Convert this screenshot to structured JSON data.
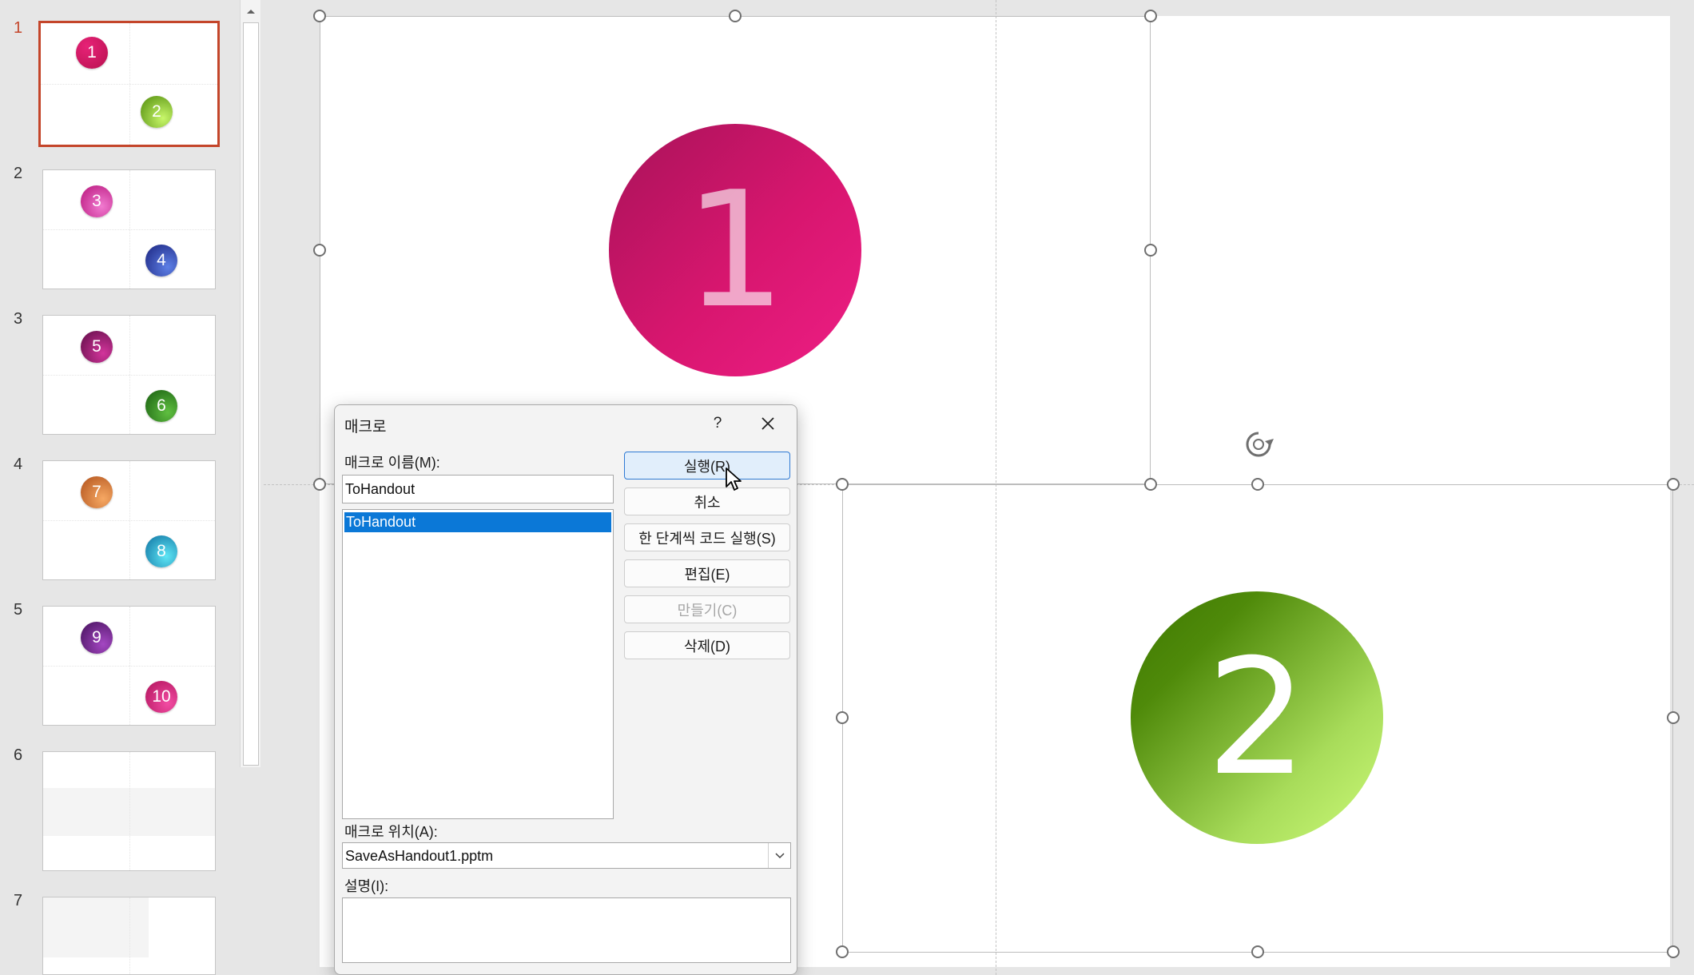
{
  "thumbnails": [
    {
      "num": "1",
      "balls": [
        "1",
        "2"
      ],
      "colors": [
        [
          "#c8145f",
          "#e72277"
        ],
        [
          "#4f8a0a",
          "#b8ef55"
        ]
      ]
    },
    {
      "num": "2",
      "balls": [
        "3",
        "4"
      ],
      "colors": [
        [
          "#b7137a",
          "#ef62c2"
        ],
        [
          "#1a237e",
          "#5472e0"
        ]
      ]
    },
    {
      "num": "3",
      "balls": [
        "5",
        "6"
      ],
      "colors": [
        [
          "#6a0f4f",
          "#c2268d"
        ],
        [
          "#1b6b12",
          "#57b33a"
        ]
      ]
    },
    {
      "num": "4",
      "balls": [
        "7",
        "8"
      ],
      "colors": [
        [
          "#b4541b",
          "#f2a15a"
        ],
        [
          "#0d7fae",
          "#54e1f3"
        ]
      ]
    },
    {
      "num": "5",
      "balls": [
        "9",
        "10"
      ],
      "colors": [
        [
          "#4b1164",
          "#9b3fb8"
        ],
        [
          "#b8135f",
          "#ee3d9a"
        ]
      ]
    },
    {
      "num": "6",
      "balls": []
    },
    {
      "num": "7",
      "balls": []
    }
  ],
  "slide": {
    "circle1": "1",
    "circle2": "2"
  },
  "dialog": {
    "title": "매크로",
    "help": "?",
    "name_label": "매크로 이름(M):",
    "name_value": "ToHandout",
    "list_items": [
      "ToHandout"
    ],
    "buttons": {
      "run": "실행(R)",
      "cancel": "취소",
      "step_into": "한 단계씩 코드 실행(S)",
      "edit": "편집(E)",
      "create": "만들기(C)",
      "delete": "삭제(D)"
    },
    "location_label": "매크로 위치(A):",
    "location_value": "SaveAsHandout1.pptm",
    "description_label": "설명(I):",
    "description_value": ""
  },
  "colors": {
    "accent": "#c4452a",
    "selection": "#0b78d7"
  }
}
